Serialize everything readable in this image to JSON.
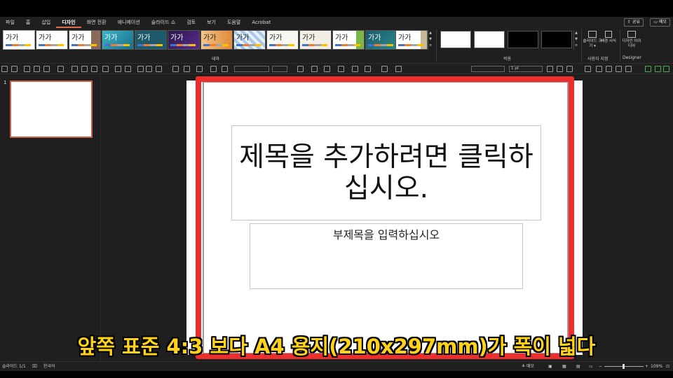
{
  "ribbon_tabs": [
    "파일",
    "홈",
    "삽입",
    "디자인",
    "화면 전환",
    "애니메이션",
    "슬라이드 쇼",
    "검토",
    "보기",
    "도움말",
    "Acrobat"
  ],
  "active_tab": "디자인",
  "share_label": "공유",
  "memo_label": "메모",
  "theme_thumb_text": "가가",
  "themes_group_label": "테마",
  "variants_group_label": "적용",
  "customize": {
    "slide_size_label": "슬라이드 크기",
    "background_label": "배경 서식",
    "group_label": "사용자 지정"
  },
  "designer": {
    "ideas_label": "디자인 아이디어",
    "group_label": "Designer"
  },
  "toolbar": {
    "line_weight": "1 pt"
  },
  "slide_panel": {
    "slide_number": "1"
  },
  "slide": {
    "title_placeholder": "제목을 추가하려면 클릭하십시오.",
    "subtitle_placeholder": "부제목을 입력하십시오"
  },
  "caption": "앞쪽 표준 4:3 보다 A4 용지(210x297mm)가 폭이 넓다",
  "status": {
    "slide_info": "슬라이드 1/1",
    "language": "한국어",
    "notes": "메모",
    "zoom": "109%"
  },
  "colors": {
    "accent": "#e06c4a",
    "highlight_frame": "#ee2d2d",
    "caption_text": "#ffd21a"
  }
}
